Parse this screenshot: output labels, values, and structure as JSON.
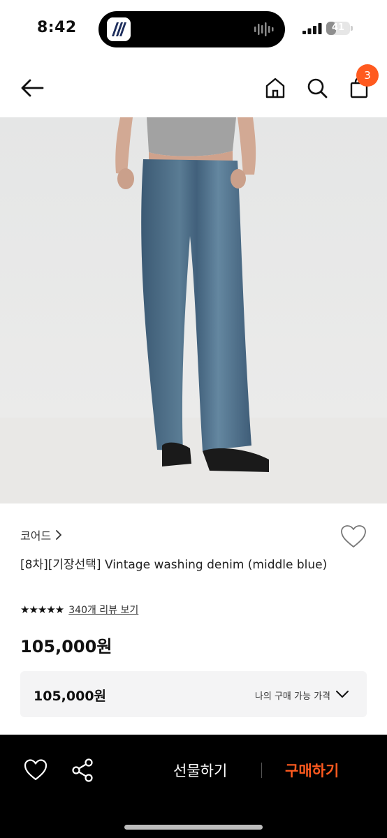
{
  "status": {
    "time": "8:42",
    "battery": "41",
    "battery_level": 0.41
  },
  "header": {
    "cart_count": "3"
  },
  "product": {
    "brand": "코어드",
    "title": "[8차][기장선택] Vintage washing denim (middle blue)",
    "rating_stars": 5,
    "review_link": "340개 리뷰 보기",
    "price": "105,000원"
  },
  "price_box": {
    "price": "105,000원",
    "label": "나의 구매 가능 가격"
  },
  "bottom_bar": {
    "gift_label": "선물하기",
    "buy_label": "구매하기"
  },
  "colors": {
    "accent": "#ff5a1f",
    "bottom_bar_bg": "#000000",
    "price_box_bg": "#f4f4f5"
  },
  "icons": [
    "back-arrow-icon",
    "home-icon",
    "search-icon",
    "shopping-bag-icon",
    "heart-icon",
    "share-icon",
    "chevron-down-icon",
    "chevron-right-icon"
  ]
}
